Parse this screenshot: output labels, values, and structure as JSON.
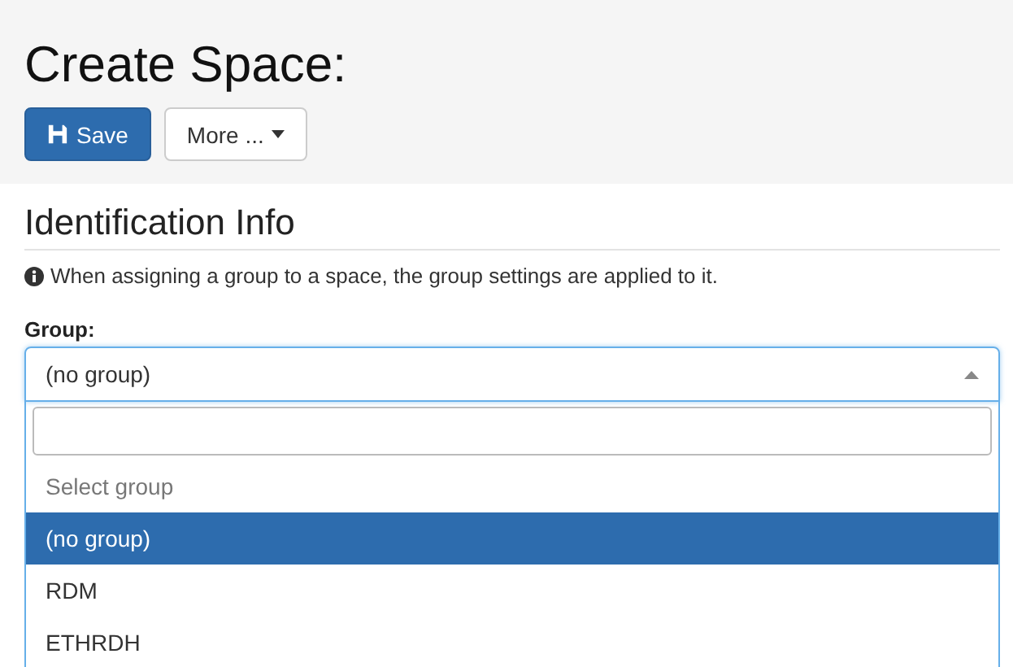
{
  "page_title": "Create Space:",
  "toolbar": {
    "save_label": "Save",
    "more_label": "More ..."
  },
  "section": {
    "heading": "Identification Info",
    "info": "When assigning a group to a space, the group settings are applied to it."
  },
  "group_field": {
    "label": "Group:",
    "value": "(no group)",
    "expanded": true,
    "options": [
      {
        "label": "Select group",
        "disabled": true,
        "selected": false
      },
      {
        "label": "(no group)",
        "disabled": false,
        "selected": true
      },
      {
        "label": "RDM",
        "disabled": false,
        "selected": false
      },
      {
        "label": "ETHRDH",
        "disabled": false,
        "selected": false
      }
    ]
  }
}
